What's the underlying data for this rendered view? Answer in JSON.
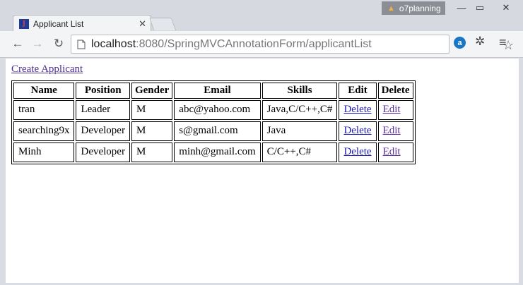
{
  "window": {
    "profile": "o7planning",
    "tab_title": "Applicant List"
  },
  "toolbar": {
    "url_host": "localhost",
    "url_rest": ":8080/SpringMVCAnnotationForm/applicantList"
  },
  "page": {
    "create_link": "Create Applicant",
    "table": {
      "headers": [
        "Name",
        "Position",
        "Gender",
        "Email",
        "Skills",
        "Edit",
        "Delete"
      ],
      "rows": [
        {
          "name": "tran",
          "position": "Leader",
          "gender": "M",
          "email": "abc@yahoo.com",
          "skills": "Java,C/C++,C#",
          "edit": "Delete",
          "delete": "Edit"
        },
        {
          "name": "searching9x",
          "position": "Developer",
          "gender": "M",
          "email": "s@gmail.com",
          "skills": "Java",
          "edit": "Delete",
          "delete": "Edit"
        },
        {
          "name": "Minh",
          "position": "Developer",
          "gender": "M",
          "email": "minh@gmail.com",
          "skills": "C/C++,C#",
          "edit": "Delete",
          "delete": "Edit"
        }
      ]
    }
  },
  "colors": {
    "link": "#1c1cb4",
    "visited_link": "#5a2ea0"
  },
  "icons": [
    "warning-icon",
    "minimize-icon",
    "maximize-icon",
    "close-icon",
    "favicon",
    "tab-close-icon",
    "back-arrow-icon",
    "forward-arrow-icon",
    "reload-icon",
    "page-icon",
    "star-icon",
    "extension-a-icon",
    "extension-bug-icon",
    "menu-icon"
  ]
}
